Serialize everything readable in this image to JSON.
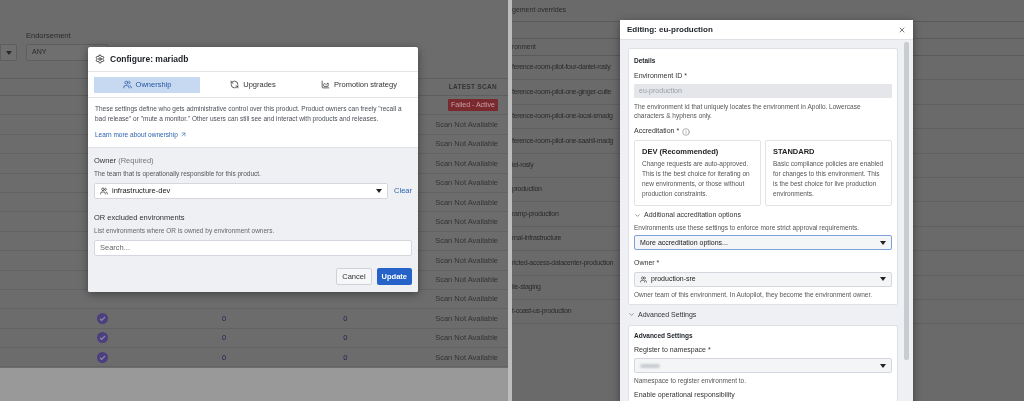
{
  "left_page": {
    "filter_label": "Endorsement",
    "filter_value": "ANY",
    "table_header": "LATEST SCAN",
    "rows": [
      {
        "scan": "Failed - Active",
        "kind": "failed"
      },
      {
        "scan": "Scan Not Available",
        "kind": "none"
      },
      {
        "scan": "Scan Not Available",
        "kind": "none"
      },
      {
        "scan": "Scan Not Available",
        "kind": "none"
      },
      {
        "scan": "Scan Not Available",
        "kind": "none"
      },
      {
        "scan": "Scan Not Available",
        "kind": "none"
      },
      {
        "scan": "Scan Not Available",
        "kind": "none"
      },
      {
        "scan": "Scan Not Available",
        "kind": "none"
      },
      {
        "scan": "Scan Not Available",
        "kind": "none"
      },
      {
        "scan": "Scan Not Available",
        "kind": "none"
      },
      {
        "scan": "Scan Not Available",
        "kind": "none"
      },
      {
        "endorsed": true,
        "column_3": "0",
        "column_4": "0",
        "scan": "Scan Not Available",
        "kind": "none"
      },
      {
        "endorsed": true,
        "column_3": "0",
        "column_4": "0",
        "scan": "Scan Not Available",
        "kind": "none"
      },
      {
        "endorsed": true,
        "column_3": "0",
        "column_4": "0",
        "scan": "Scan Not Available",
        "kind": "none"
      }
    ]
  },
  "configure_dialog": {
    "title": "Configure: mariadb",
    "tabs": [
      {
        "label": "Ownership",
        "selected": true,
        "kind": "people"
      },
      {
        "label": "Upgrades",
        "selected": false,
        "kind": "cycle"
      },
      {
        "label": "Promotion strategy",
        "selected": false,
        "kind": "chart"
      }
    ],
    "description": "These settings define who gets administrative control over this product. Product owners can freely \"recall a bad release\" or \"mute a monitor.\" Other users can still see and interact with products and releases.",
    "link": "Learn more about ownership",
    "owner_label": "Owner",
    "owner_note": "(Required)",
    "owner_help": "The team that is operationally responsible for this product.",
    "owner_value": "infrastructure-dev",
    "clear": "Clear",
    "excluded_label": "OR excluded environments",
    "excluded_help": "List environments where OR is owned by environment owners.",
    "search_placeholder": "Search...",
    "buttons": [
      {
        "label": "Cancel",
        "kind": "secondary"
      },
      {
        "label": "Update",
        "kind": "primary"
      }
    ]
  },
  "right_page": {
    "heading": "gement overrides",
    "column_header": "ronment",
    "rows": [
      "ference-room-pilot-four-daniel-rosly",
      "ference-room-pilot-one-ginger-cutle",
      "ference-room-pilot-one-local-smadg",
      "ference-room-pilot-one-saahil-madg",
      "iel-rosly",
      "production",
      "ramp-production",
      "rnal-infrastructure",
      "ricted-access-datacenter-production",
      "ile-staging",
      "t-coast-us-production"
    ]
  },
  "edit_dialog": {
    "title": "Editing: eu-production",
    "details": {
      "heading": "Details",
      "env_id_label": "Environment ID *",
      "env_id_value": "eu-production",
      "env_id_disabled": true,
      "env_id_help": "The environment id that uniquely locates the environment in Apollo. Lowercase characters & hyphens only.",
      "accreditation_label": "Accreditation *",
      "options": [
        {
          "title": "DEV (Recommended)",
          "text": "Change requests are auto-approved. This is the best choice for iterating on new environments, or those without production constraints."
        },
        {
          "title": "STANDARD",
          "text": "Basic compliance policies are enabled for changes to this environment. This is the best choice for live production environments."
        }
      ],
      "additional": {
        "label": "Additional accreditation options",
        "expanded": true,
        "help": "Environments use these settings to enforce more strict approval requirements.",
        "select": "More accreditation options...",
        "focused": true
      },
      "owner_label": "Owner *",
      "owner_value": "production-sre",
      "owner_help": "Owner team of this environment. In Autopilot, they become the environment owner."
    },
    "advanced": {
      "toggle": "Advanced Settings",
      "expanded": true,
      "heading": "Advanced Settings",
      "namespace_label": "Register to namespace *",
      "namespace_help": "Namespace to register environment to.",
      "operational_label": "Enable operational responsibility"
    }
  }
}
